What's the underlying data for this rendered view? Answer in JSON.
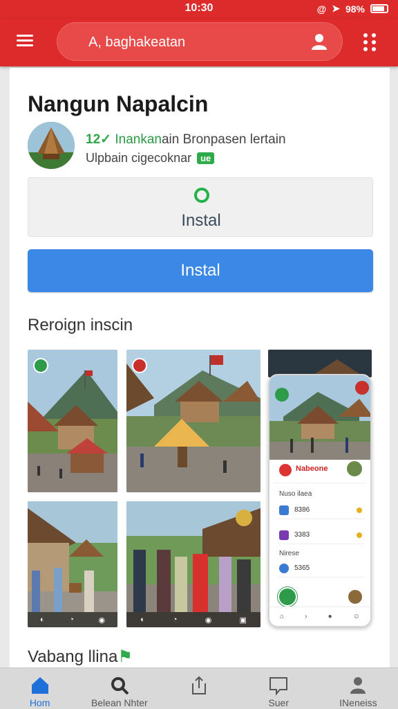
{
  "status": {
    "time": "10:30",
    "battery": "98%"
  },
  "search": {
    "text": "A, baghakeatan"
  },
  "app": {
    "title": "Nangun Napalcin",
    "developer_check": "12",
    "developer_brand": "Inankan",
    "developer_rest": "ain Bronpasen lertain",
    "sub": "Ulpbain cigecoknar",
    "badge": "ue",
    "status_label": "Instal",
    "install_label": "Instal"
  },
  "section_title": "Reroign inscin",
  "phone": {
    "popup_title": "Nabeone",
    "section1": "Nuso ilaea",
    "rows": [
      {
        "value": "8386"
      },
      {
        "value": "3383"
      }
    ],
    "section2": "Nirese",
    "row3": "5365"
  },
  "bottom_title": "Vabang llina",
  "nav": [
    {
      "label": "Hom",
      "icon": "home-icon"
    },
    {
      "label": "Belean Nhter",
      "icon": "search-icon"
    },
    {
      "label": "",
      "icon": "share-icon"
    },
    {
      "label": "Suer",
      "icon": "chat-icon"
    },
    {
      "label": "INeneiss",
      "icon": "profile-icon"
    }
  ],
  "colors": {
    "brand_red": "#dd2b2b",
    "install_blue": "#3b88e6",
    "accent_green": "#2faa4a"
  }
}
